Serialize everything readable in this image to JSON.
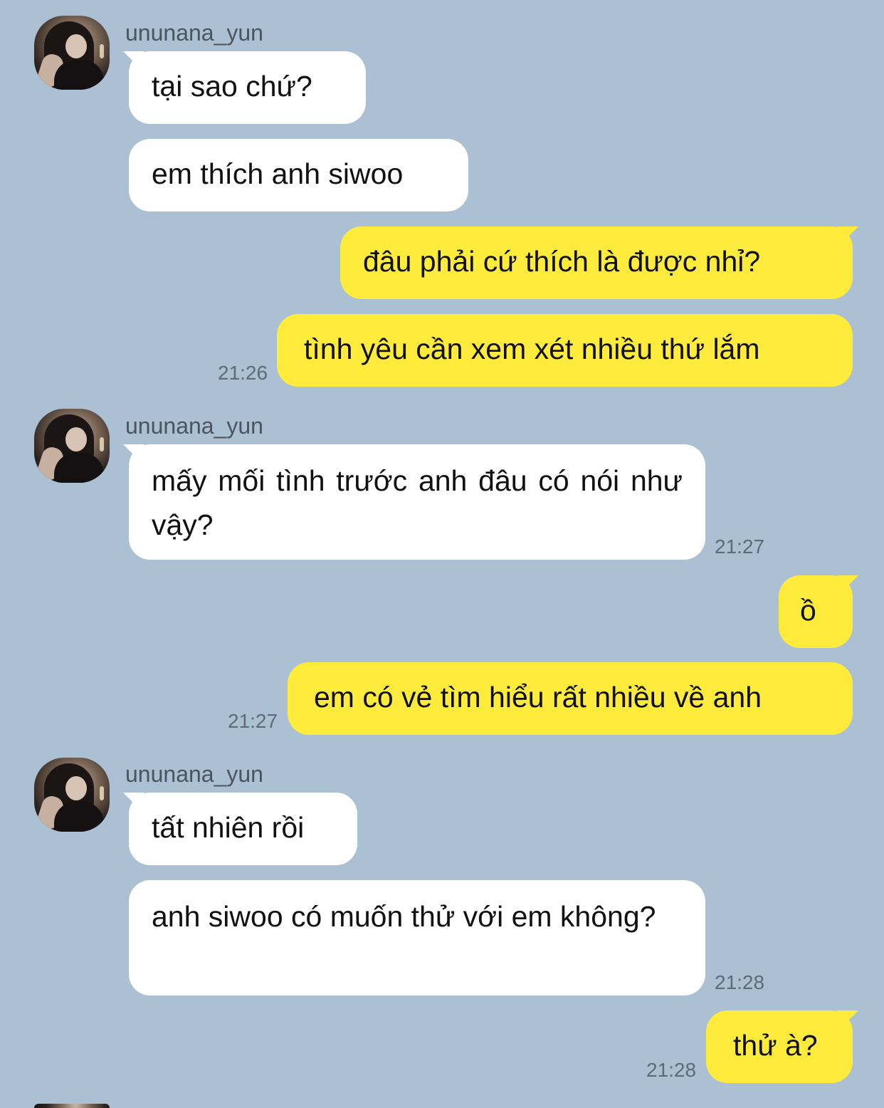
{
  "chat": {
    "groups": [
      {
        "username": "ununana_yun",
        "messages": [
          {
            "text": "tại sao chứ?"
          },
          {
            "text": "em thích anh siwoo"
          }
        ]
      },
      {
        "messages": [
          {
            "text": "đâu phải cứ thích là được nhỉ?"
          },
          {
            "text": "tình yêu cần xem xét nhiều thứ lắm",
            "time": "21:26"
          }
        ]
      },
      {
        "username": "ununana_yun",
        "messages": [
          {
            "text": "mấy mối tình trước anh đâu có nói như vậy?",
            "time": "21:27"
          }
        ]
      },
      {
        "messages": [
          {
            "text": "ồ"
          },
          {
            "text": "em có vẻ tìm hiểu rất nhiều về anh",
            "time": "21:27"
          }
        ]
      },
      {
        "username": "ununana_yun",
        "messages": [
          {
            "text": "tất nhiên rồi"
          },
          {
            "text": "anh siwoo có muốn thử với em không?",
            "time": "21:28"
          }
        ]
      },
      {
        "messages": [
          {
            "text": "thử à?",
            "time": "21:28"
          }
        ]
      }
    ]
  },
  "colors": {
    "background": "#abc0d3",
    "incoming_bubble": "#ffffff",
    "outgoing_bubble": "#ffeb3b",
    "timestamp": "#5d6b78"
  }
}
